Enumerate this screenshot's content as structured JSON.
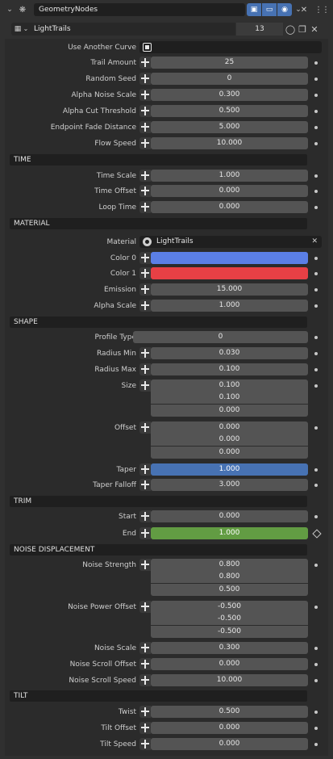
{
  "header": {
    "modifier_name": "GeometryNodes",
    "node_group": "LightTrails",
    "user_count": "13",
    "close_label": "✕"
  },
  "inputs": {
    "use_another_curve": "Use Another Curve",
    "trail_amount": {
      "label": "Trail Amount",
      "value": "25"
    },
    "random_seed": {
      "label": "Random Seed",
      "value": "0"
    },
    "alpha_noise_scale": {
      "label": "Alpha Noise Scale",
      "value": "0.300"
    },
    "alpha_cut_threshold": {
      "label": "Alpha Cut Threshold",
      "value": "0.500"
    },
    "endpoint_fade_distance": {
      "label": "Endpoint Fade Distance",
      "value": "5.000"
    },
    "flow_speed": {
      "label": "Flow Speed",
      "value": "10.000"
    }
  },
  "time": {
    "title": "TIME",
    "time_scale": {
      "label": "Time Scale",
      "value": "1.000"
    },
    "time_offset": {
      "label": "Time Offset",
      "value": "0.000"
    },
    "loop_time": {
      "label": "Loop Time",
      "value": "0.000"
    }
  },
  "material": {
    "title": "MATERIAL",
    "material": {
      "label": "Material",
      "value": "LightTrails",
      "clear": "✕"
    },
    "color0": {
      "label": "Color 0",
      "color": "#5b7fe6"
    },
    "color1": {
      "label": "Color 1",
      "color": "#e74045"
    },
    "emission": {
      "label": "Emission",
      "value": "15.000"
    },
    "alpha_scale": {
      "label": "Alpha Scale",
      "value": "1.000"
    }
  },
  "shape": {
    "title": "SHAPE",
    "profile_type": {
      "label": "Profile Type",
      "value": "0"
    },
    "radius_min": {
      "label": "Radius Min",
      "value": "0.030"
    },
    "radius_max": {
      "label": "Radius Max",
      "value": "0.100"
    },
    "size": {
      "label": "Size",
      "values": [
        "0.100",
        "0.100",
        "0.000"
      ]
    },
    "offset": {
      "label": "Offset",
      "values": [
        "0.000",
        "0.000",
        "0.000"
      ]
    },
    "taper": {
      "label": "Taper",
      "value": "1.000"
    },
    "taper_falloff": {
      "label": "Taper Falloff",
      "value": "3.000"
    }
  },
  "trim": {
    "title": "TRIM",
    "start": {
      "label": "Start",
      "value": "0.000"
    },
    "end": {
      "label": "End",
      "value": "1.000"
    }
  },
  "noise": {
    "title": "NOISE DISPLACEMENT",
    "noise_strength": {
      "label": "Noise Strength",
      "values": [
        "0.800",
        "0.800",
        "0.500"
      ]
    },
    "noise_power_offset": {
      "label": "Noise Power Offset",
      "values": [
        "-0.500",
        "-0.500",
        "-0.500"
      ]
    },
    "noise_scale": {
      "label": "Noise Scale",
      "value": "0.300"
    },
    "noise_scroll_offset": {
      "label": "Noise Scroll Offset",
      "value": "0.000"
    },
    "noise_scroll_speed": {
      "label": "Noise Scroll Speed",
      "value": "10.000"
    }
  },
  "tilt": {
    "title": "TILT",
    "twist": {
      "label": "Twist",
      "value": "0.500"
    },
    "tilt_offset": {
      "label": "Tilt Offset",
      "value": "0.000"
    },
    "tilt_speed": {
      "label": "Tilt Speed",
      "value": "0.000"
    }
  },
  "colors": {
    "accent": "#4772b3",
    "panel": "#2b2b2b",
    "field": "#545454",
    "section": "#1f1f1f",
    "end_field": "#629c43"
  }
}
